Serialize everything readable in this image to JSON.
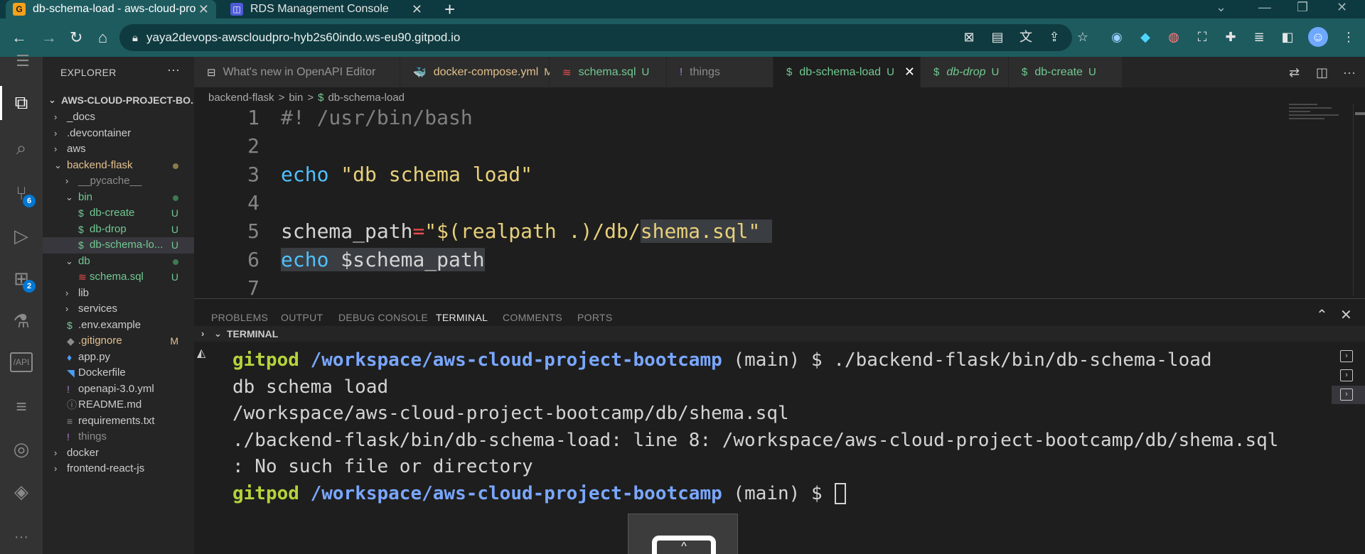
{
  "browser": {
    "tabs": [
      {
        "title": "db-schema-load - aws-cloud-pro",
        "favicon": "gitpod-icon",
        "active": true
      },
      {
        "title": "RDS Management Console",
        "favicon": "rds-icon",
        "active": false
      }
    ],
    "new_tab": "+",
    "url": "yaya2devops-awscloudpro-hyb2s60indo.ws-eu90.gitpod.io"
  },
  "activity_bar": {
    "items": [
      {
        "name": "explorer-icon",
        "glyph": "⧉"
      },
      {
        "name": "search-icon",
        "glyph": "⌕"
      },
      {
        "name": "source-control-icon",
        "glyph": "⑂",
        "badge": "6"
      },
      {
        "name": "run-debug-icon",
        "glyph": "▷"
      },
      {
        "name": "extensions-icon",
        "glyph": "⊞",
        "badge": "2"
      },
      {
        "name": "testing-icon",
        "glyph": "⚗"
      },
      {
        "name": "api-icon",
        "glyph": "/API"
      },
      {
        "name": "database-icon",
        "glyph": "≡"
      },
      {
        "name": "github-icon",
        "glyph": "◎"
      },
      {
        "name": "aws-icon",
        "glyph": "◈"
      },
      {
        "name": "more-icon",
        "glyph": "···"
      }
    ]
  },
  "explorer": {
    "title": "EXPLORER",
    "more": "···",
    "root": "AWS-CLOUD-PROJECT-BO...",
    "items": [
      {
        "label": "_docs",
        "chev": "›",
        "indent": 0,
        "color": "#cccccc"
      },
      {
        "label": ".devcontainer",
        "chev": "›",
        "indent": 0,
        "color": "#cccccc"
      },
      {
        "label": "aws",
        "chev": "›",
        "indent": 0,
        "color": "#cccccc"
      },
      {
        "label": "backend-flask",
        "chev": "⌄",
        "indent": 0,
        "color": "#e2c08d",
        "dot": "#8a7a4a"
      },
      {
        "label": "__pycache__",
        "chev": "›",
        "indent": 1,
        "color": "#8c8c8c"
      },
      {
        "label": "bin",
        "chev": "⌄",
        "indent": 1,
        "color": "#73c991",
        "dot": "#3d7a4f"
      },
      {
        "label": "db-create",
        "icon": "$",
        "indent": 2,
        "color": "#73c991",
        "status": "U"
      },
      {
        "label": "db-drop",
        "icon": "$",
        "indent": 2,
        "color": "#73c991",
        "status": "U"
      },
      {
        "label": "db-schema-lo...",
        "icon": "$",
        "indent": 2,
        "color": "#73c991",
        "status": "U",
        "selected": true
      },
      {
        "label": "db",
        "chev": "⌄",
        "indent": 1,
        "color": "#73c991",
        "dot": "#3d7a4f"
      },
      {
        "label": "schema.sql",
        "icon": "≋",
        "indent": 2,
        "color": "#73c991",
        "status": "U"
      },
      {
        "label": "lib",
        "chev": "›",
        "indent": 1,
        "color": "#cccccc"
      },
      {
        "label": "services",
        "chev": "›",
        "indent": 1,
        "color": "#cccccc"
      },
      {
        "label": ".env.example",
        "icon": "$",
        "indent": 1,
        "color": "#cccccc"
      },
      {
        "label": ".gitignore",
        "icon": "◆",
        "indent": 1,
        "color": "#e2c08d",
        "status": "M"
      },
      {
        "label": "app.py",
        "icon": "♦",
        "indent": 1,
        "color": "#cccccc"
      },
      {
        "label": "Dockerfile",
        "icon": "◥",
        "indent": 1,
        "color": "#cccccc"
      },
      {
        "label": "openapi-3.0.yml",
        "icon": "!",
        "indent": 1,
        "color": "#cccccc"
      },
      {
        "label": "README.md",
        "icon": "ⓘ",
        "indent": 1,
        "color": "#cccccc"
      },
      {
        "label": "requirements.txt",
        "icon": "≡",
        "indent": 1,
        "color": "#cccccc"
      },
      {
        "label": "things",
        "icon": "!",
        "indent": 1,
        "color": "#8c8c8c"
      },
      {
        "label": "docker",
        "chev": "›",
        "indent": 0,
        "color": "#cccccc"
      },
      {
        "label": "frontend-react-js",
        "chev": "›",
        "indent": 0,
        "color": "#cccccc"
      }
    ]
  },
  "editor": {
    "tabs": [
      {
        "label": "What's new in OpenAPI Editor",
        "icon": "⊟",
        "icon_color": "#c5c5c5",
        "status": "",
        "italic": false,
        "active": false
      },
      {
        "label": "docker-compose.yml",
        "icon": "🐳",
        "icon_color": "#f14c4c",
        "status": "M",
        "status_color": "#e2c08d",
        "label_color": "#e2c08d",
        "italic": false,
        "active": false
      },
      {
        "label": "schema.sql",
        "icon": "≋",
        "icon_color": "#f14c4c",
        "status": "U",
        "status_color": "#73c991",
        "label_color": "#73c991",
        "italic": false,
        "active": false
      },
      {
        "label": "things",
        "icon": "!",
        "icon_color": "#b180d7",
        "status": "",
        "label_color": "#8c8c8c",
        "italic": false,
        "active": false
      },
      {
        "label": "db-schema-load",
        "icon": "$",
        "icon_color": "#73c991",
        "status": "U",
        "status_color": "#73c991",
        "label_color": "#73c991",
        "italic": false,
        "active": true,
        "close": "✕"
      },
      {
        "label": "db-drop",
        "icon": "$",
        "icon_color": "#73c991",
        "status": "U",
        "status_color": "#73c991",
        "label_color": "#73c991",
        "italic": true,
        "active": false
      },
      {
        "label": "db-create",
        "icon": "$",
        "icon_color": "#73c991",
        "status": "U",
        "status_color": "#73c991",
        "label_color": "#73c991",
        "italic": false,
        "active": false
      }
    ],
    "breadcrumb": [
      "backend-flask",
      ">",
      "bin",
      ">",
      "$",
      "db-schema-load"
    ],
    "lines": [
      {
        "n": "1",
        "segments": [
          {
            "t": "#! /usr/bin/bash",
            "c": "c-comment gray"
          }
        ]
      },
      {
        "n": "2",
        "segments": []
      },
      {
        "n": "3",
        "segments": [
          {
            "t": "echo",
            "c": "c-kw"
          },
          {
            "t": " ",
            "c": "c-var"
          },
          {
            "t": "\"db schema load\"",
            "c": "c-strlt"
          }
        ]
      },
      {
        "n": "4",
        "segments": []
      },
      {
        "n": "5",
        "segments": [
          {
            "t": "schema_path",
            "c": "c-var"
          },
          {
            "t": "=",
            "c": "c-op"
          },
          {
            "t": "\"$(realpath .)/db/",
            "c": "c-strlt"
          },
          {
            "t": "shema.sql\" ",
            "c": "c-strlt hl"
          }
        ]
      },
      {
        "n": "6",
        "segments": [
          {
            "t": "echo",
            "c": "c-kw hl"
          },
          {
            "t": " $schema_path",
            "c": "c-var hl"
          }
        ]
      },
      {
        "n": "7",
        "segments": []
      }
    ]
  },
  "panel": {
    "tabs": [
      "PROBLEMS",
      "OUTPUT",
      "DEBUG CONSOLE",
      "TERMINAL",
      "COMMENTS",
      "PORTS"
    ],
    "active_tab": "TERMINAL",
    "terminal_header": "TERMINAL",
    "lines": [
      {
        "prompt_user": "gitpod",
        "prompt_path": "/workspace/aws-cloud-project-bootcamp",
        "prompt_rest": " (main) $ ",
        "cmd": "./backend-flask/bin/db-schema-load"
      },
      {
        "text": "db schema load"
      },
      {
        "text": "/workspace/aws-cloud-project-bootcamp/db/shema.sql"
      },
      {
        "text": "./backend-flask/bin/db-schema-load: line 8: /workspace/aws-cloud-project-bootcamp/db/shema.sql"
      },
      {
        "text": ": No such file or directory"
      },
      {
        "prompt_user": "gitpod",
        "prompt_path": "/workspace/aws-cloud-project-bootcamp",
        "prompt_rest": " (main) $ ",
        "cmd": "",
        "cursor": true
      }
    ]
  }
}
